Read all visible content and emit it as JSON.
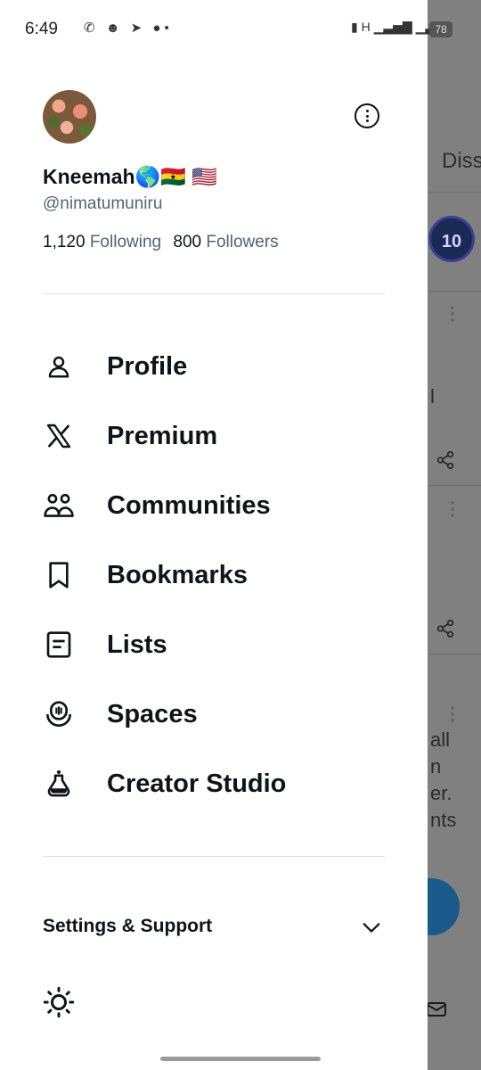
{
  "status_bar": {
    "time": "6:49",
    "notification_icons": [
      "whatsapp-icon",
      "snapchat-icon",
      "telegram-icon",
      "chat-icon",
      "dot"
    ],
    "network": "H",
    "battery": "78"
  },
  "background": {
    "tab_partial": "Diss",
    "badge_value": "10",
    "text_fragments": [
      "l",
      "all",
      "n",
      "er.",
      "nts"
    ]
  },
  "profile": {
    "display_name": "Kneemah🌎🇬🇭 🇺🇸",
    "handle": "@nimatumuniru",
    "following_count": "1,120",
    "following_label": "Following",
    "followers_count": "800",
    "followers_label": "Followers"
  },
  "menu": {
    "items": [
      {
        "label": "Profile",
        "icon": "person-icon"
      },
      {
        "label": "Premium",
        "icon": "x-logo-icon"
      },
      {
        "label": "Communities",
        "icon": "communities-icon"
      },
      {
        "label": "Bookmarks",
        "icon": "bookmark-icon"
      },
      {
        "label": "Lists",
        "icon": "list-icon"
      },
      {
        "label": "Spaces",
        "icon": "spaces-icon"
      },
      {
        "label": "Creator Studio",
        "icon": "creator-studio-icon"
      }
    ]
  },
  "settings": {
    "label": "Settings & Support"
  },
  "colors": {
    "text_primary": "#0f1419",
    "text_secondary": "#536471",
    "divider": "#dfe3e6",
    "overlay": "#808080"
  }
}
